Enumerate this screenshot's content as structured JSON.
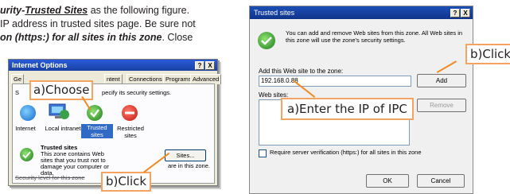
{
  "intro": {
    "line1_lead": "urity",
    "line1_sep": "-",
    "line1_link": "Trusted Sites",
    "line1_tail": " as the following figure.",
    "line2": "IP address in trusted sites page. Be sure not",
    "line3_bold": "on (https:) for all sites in this zone",
    "line3_tail": ". Close"
  },
  "options_dialog": {
    "title": "Internet Options",
    "help": "?",
    "close": "X",
    "tabs": [
      "Ge",
      "ntent",
      "Connections",
      "Programs",
      "Advanced"
    ],
    "select_text_left": "S",
    "select_text_right": "pecify its security settings.",
    "zones": [
      "Internet",
      "Local intranet",
      "Trusted sites",
      "Restricted sites"
    ],
    "zone_heading": "Trusted sites",
    "zone_desc": "This zone contains Web sites that you trust not to damage your computer or data.",
    "zone_desc_right": "are in this zone.",
    "zone_desc_bottom": "Security level for this zone",
    "sites_button": "Sites..."
  },
  "callouts": {
    "choose": "a)Choose",
    "click_left": "b)Click",
    "enter_ip": "a)Enter the IP of IPC",
    "click_right": "b)Click"
  },
  "trusted_dialog": {
    "title": "Trusted sites",
    "help": "?",
    "close": "X",
    "info_text": "You can add and remove Web sites from this zone. All Web sites in this zone will use the zone's security settings.",
    "add_label": "Add this Web site to the zone:",
    "ip_value": "192.168.0.88",
    "add_button": "Add",
    "websites_label": "Web sites:",
    "remove_button": "Remove",
    "require_label": "Require server verification (https:) for all sites in this zone",
    "ok_button": "OK",
    "cancel_button": "Cancel"
  },
  "colors": {
    "callout_border": "#f4a460",
    "arrow": "#f08a24",
    "title_bar": "#1941a5"
  }
}
